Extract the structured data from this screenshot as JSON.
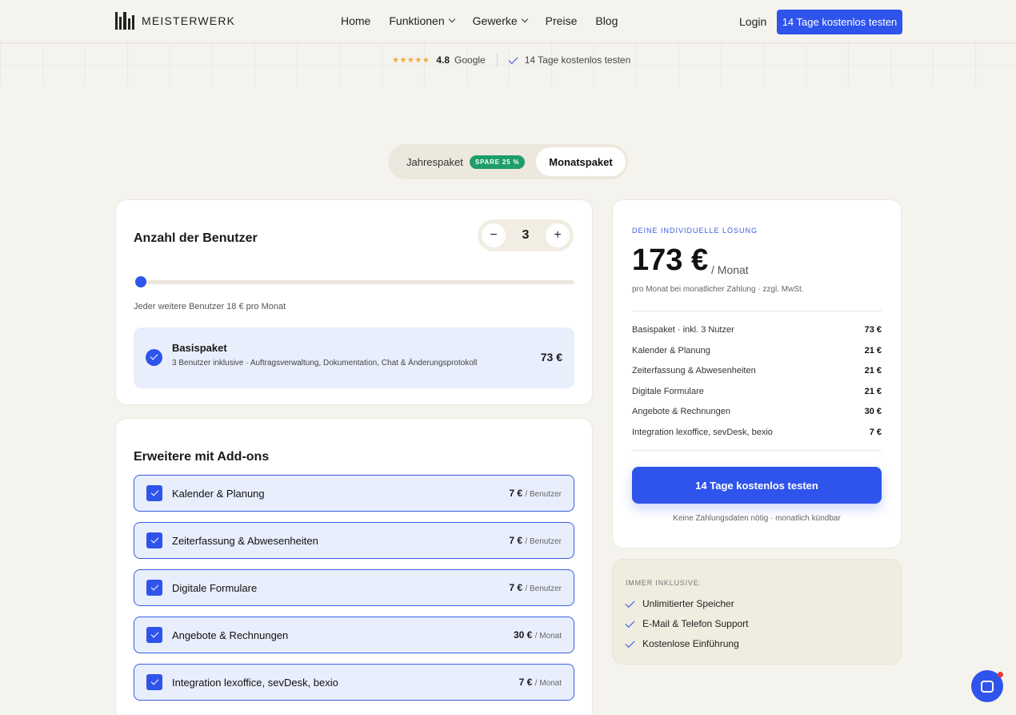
{
  "brand": {
    "name": "MEISTERWERK"
  },
  "nav": {
    "home": "Home",
    "funktionen": "Funktionen",
    "gewerke": "Gewerke",
    "preise": "Preise",
    "blog": "Blog",
    "login": "Login",
    "cta": "14 Tage kostenlos testen"
  },
  "rating": {
    "stars": "★★★★★",
    "score": "4.8",
    "source": "Google",
    "trial": "14 Tage kostenlos testen"
  },
  "billing_toggle": {
    "annual": "Jahrespaket",
    "badge": "SPARE 25 %",
    "monthly": "Monatspaket",
    "selected": "Monatspaket"
  },
  "users": {
    "title": "Anzahl der Benutzer",
    "count": "3",
    "minus": "−",
    "plus": "+",
    "slider_fraction": 0.0,
    "hint": "Jeder weitere Benutzer 18 € pro Monat"
  },
  "basis": {
    "title": "Basispaket",
    "desc": "3 Benutzer inklusive · Auftragsverwaltung, Dokumentation, Chat & Änderungsprotokoll",
    "price": "73 €"
  },
  "addons": {
    "title": "Erweitere mit Add-ons",
    "items": [
      {
        "name": "Kalender & Planung",
        "price": "7 €",
        "unit": "/ Benutzer",
        "checked": true
      },
      {
        "name": "Zeiterfassung & Abwesenheiten",
        "price": "7 €",
        "unit": "/ Benutzer",
        "checked": true
      },
      {
        "name": "Digitale Formulare",
        "price": "7 €",
        "unit": "/ Benutzer",
        "checked": true
      },
      {
        "name": "Angebote & Rechnungen",
        "price": "30 €",
        "unit": "/ Monat",
        "checked": true
      },
      {
        "name": "Integration lexoffice, sevDesk, bexio",
        "price": "7 €",
        "unit": "/ Monat",
        "checked": true
      }
    ]
  },
  "summary": {
    "eyebrow": "DEINE INDIVIDUELLE LÖSUNG",
    "price": "173 €",
    "per": "/ Monat",
    "note": "pro Monat bei monatlicher Zahlung · zzgl. MwSt.",
    "lines": [
      {
        "label": "Basispaket · inkl. 3 Nutzer",
        "amount": "73 €"
      },
      {
        "label": "Kalender & Planung",
        "amount": "21 €"
      },
      {
        "label": "Zeiterfassung & Abwesenheiten",
        "amount": "21 €"
      },
      {
        "label": "Digitale Formulare",
        "amount": "21 €"
      },
      {
        "label": "Angebote & Rechnungen",
        "amount": "30 €"
      },
      {
        "label": "Integration lexoffice, sevDesk, bexio",
        "amount": "7 €"
      }
    ],
    "cta": "14 Tage kostenlos testen",
    "fine": "Keine Zahlungsdaten nötig · monatlich kündbar"
  },
  "included": {
    "title": "IMMER INKLUSIVE:",
    "items": [
      "Unlimitierter Speicher",
      "E-Mail & Telefon Support",
      "Kostenlose Einführung"
    ]
  },
  "colors": {
    "accent": "#2f54eb",
    "badge": "#1f9d6a",
    "background": "#f5f3ee"
  },
  "icons": {
    "chat": "chat-bubble-icon",
    "check": "check-icon"
  }
}
